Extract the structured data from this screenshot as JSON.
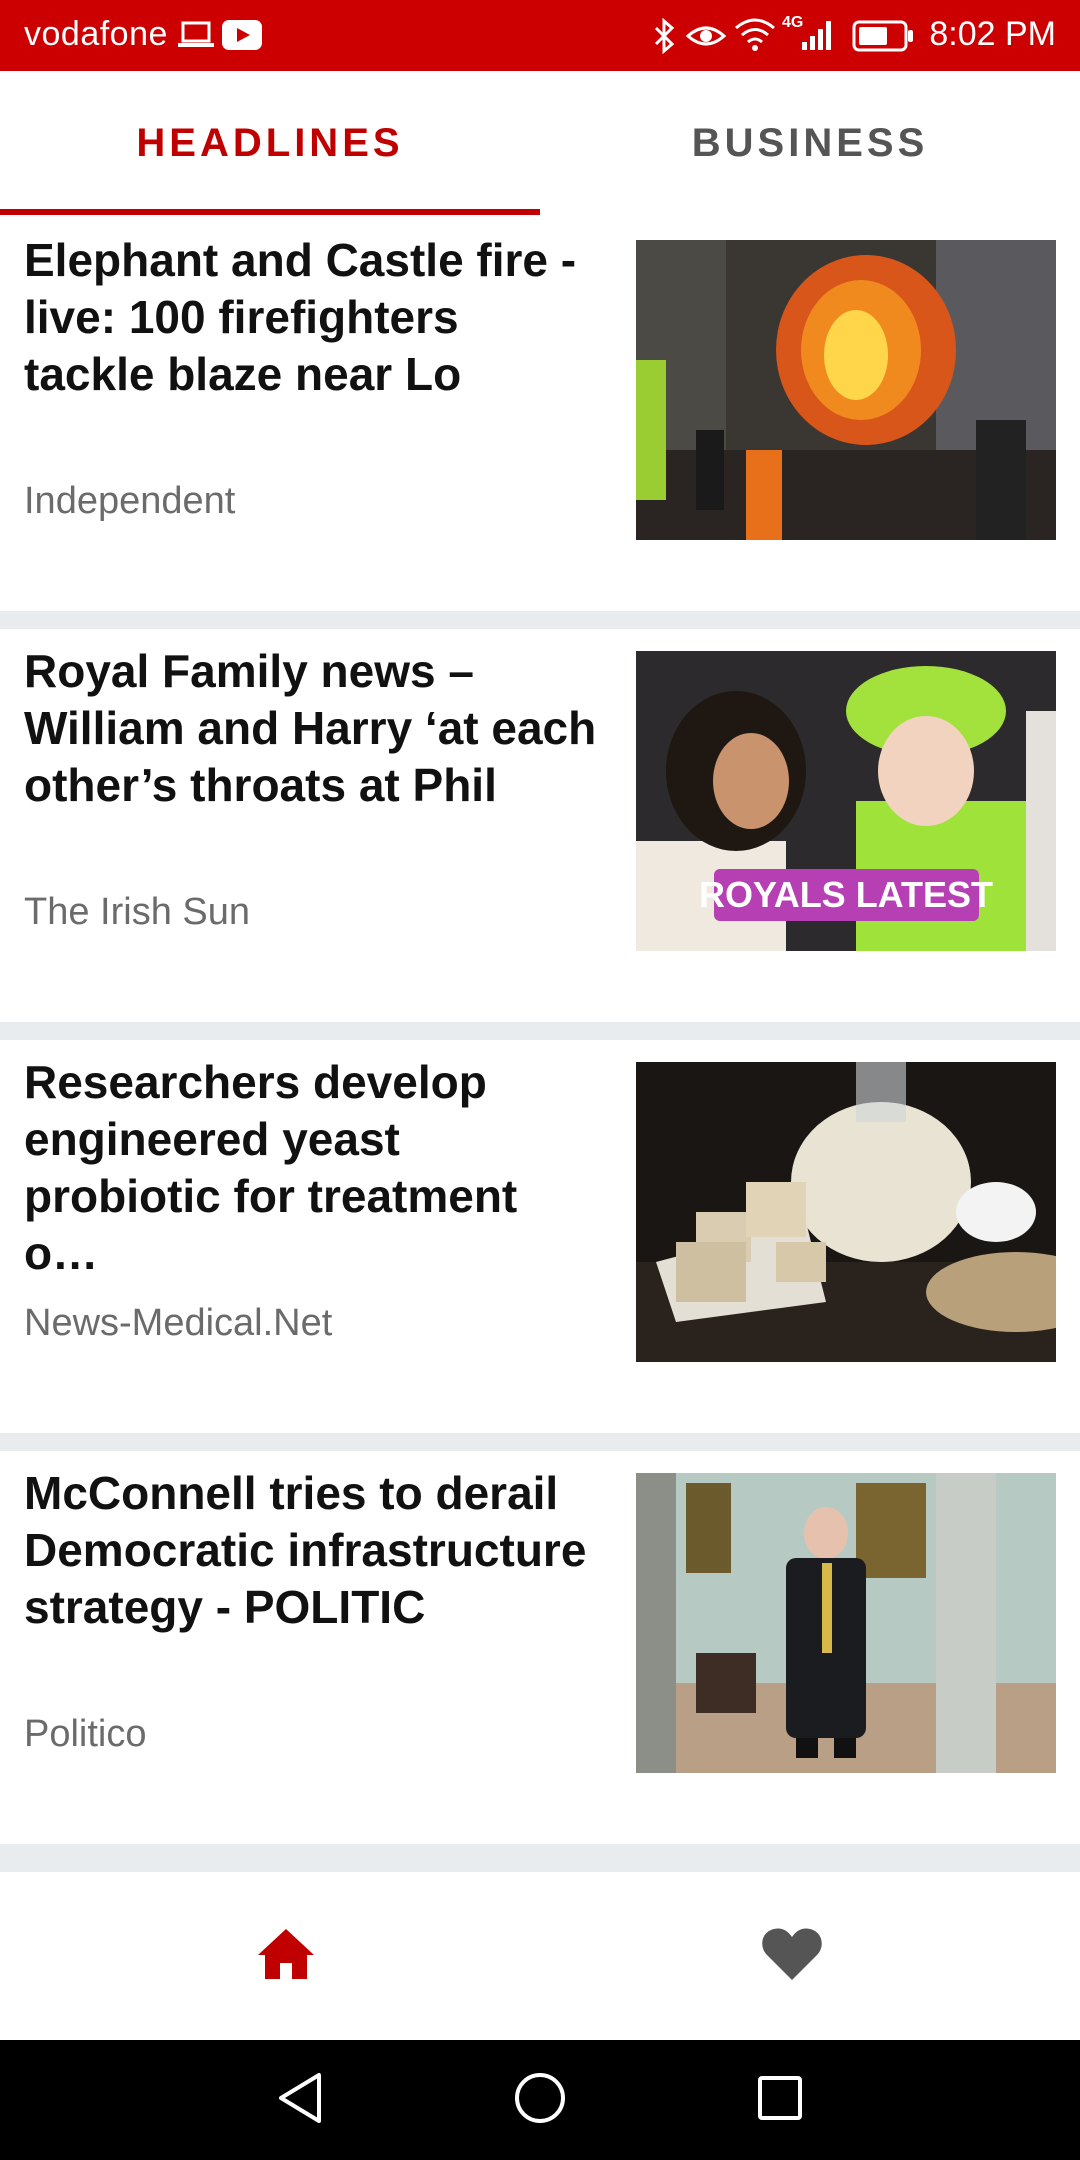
{
  "status_bar": {
    "carrier": "vodafone",
    "time": "8:02 PM",
    "network": "4G",
    "icons": [
      "laptop-icon",
      "youtube-icon",
      "bluetooth-icon",
      "eye-icon",
      "wifi-icon",
      "signal-icon",
      "battery-icon"
    ]
  },
  "tabs": [
    {
      "label": "HEADLINES",
      "active": true
    },
    {
      "label": "BUSINESS",
      "active": false
    }
  ],
  "colors": {
    "accent": "#cc0000",
    "tab_active": "#c00000",
    "separator": "#e9ecef",
    "source_text": "#6b6b6b"
  },
  "articles": [
    {
      "title": "Elephant and Castle fire - live: 100 firefighters tackle blaze near Lo",
      "source": "Independent",
      "image": "fire-photo"
    },
    {
      "title": "Royal Family news – William and Harry ‘at each other’s throats at Phil",
      "source": "The Irish Sun",
      "image": "royals-photo",
      "image_overlay": "ROYALS LATEST"
    },
    {
      "title": "Researchers develop engineered yeast probiotic for treatment o…",
      "source": "News-Medical.Net",
      "image": "yeast-photo"
    },
    {
      "title": "McConnell tries to derail Democratic infrastructure strategy - POLITIC",
      "source": "Politico",
      "image": "politician-photo"
    }
  ],
  "bottom_nav": [
    "home-icon",
    "heart-icon"
  ],
  "system_nav": [
    "back-icon",
    "home-circle-icon",
    "recents-icon"
  ]
}
